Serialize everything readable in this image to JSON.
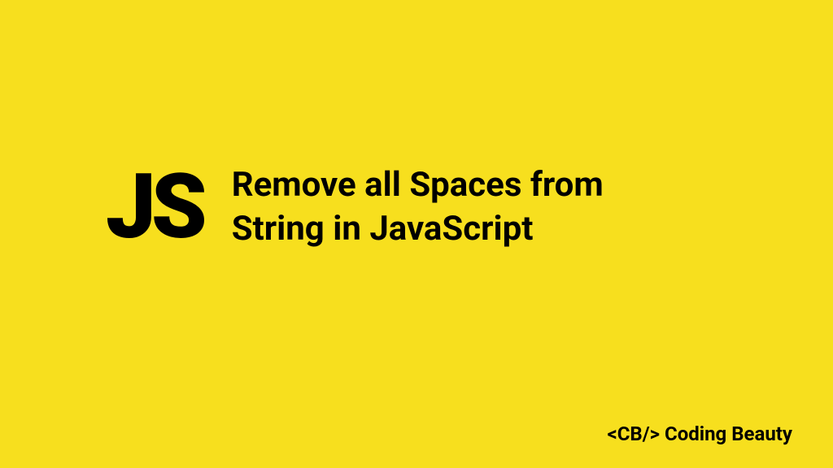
{
  "badge": "JS",
  "title": "Remove all Spaces from String in JavaScript",
  "brand": {
    "tag": "<CB/>",
    "name": "Coding Beauty"
  }
}
